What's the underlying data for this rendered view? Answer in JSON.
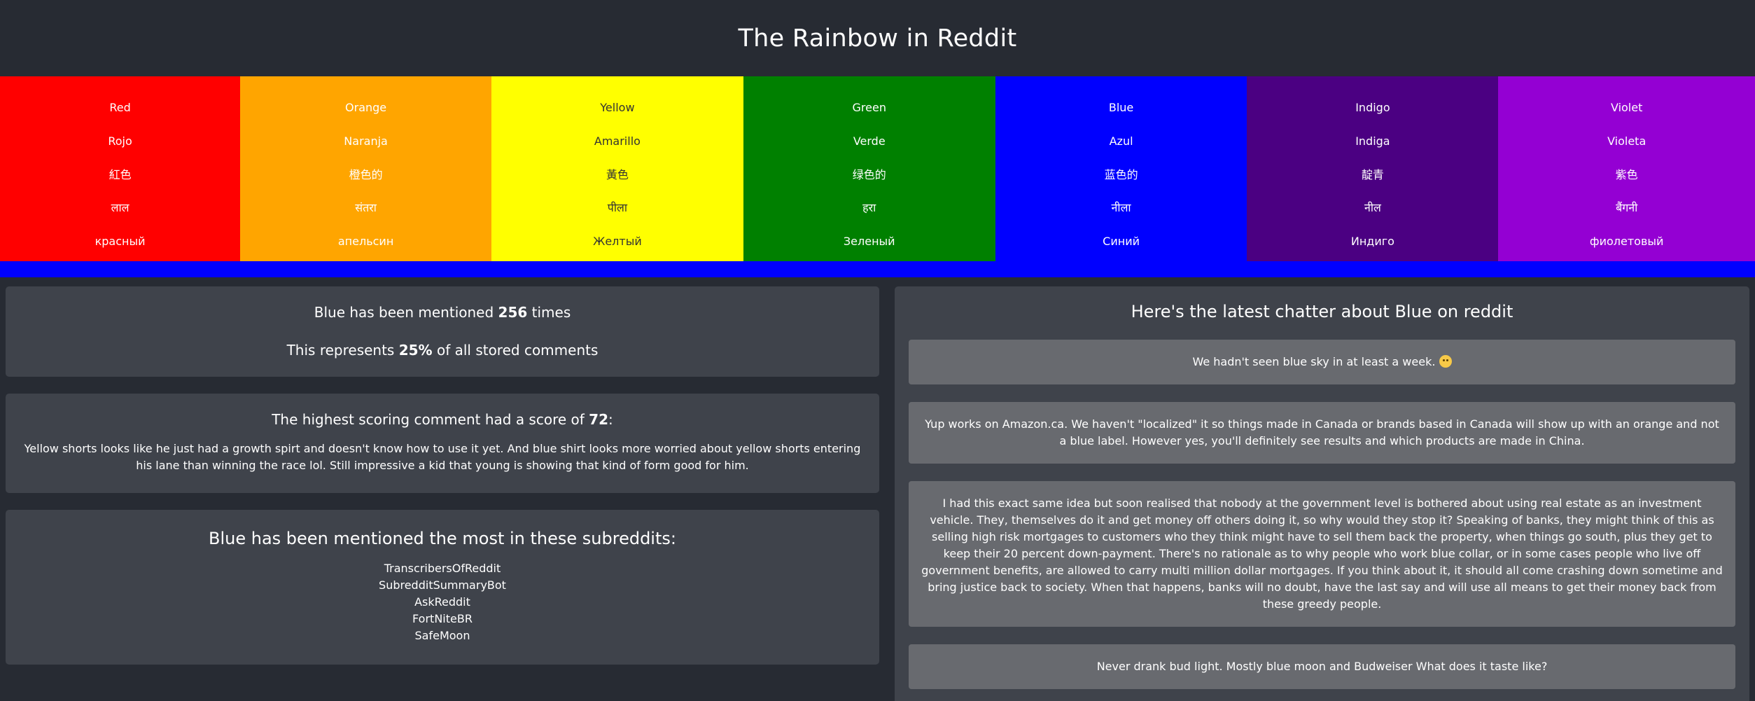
{
  "header": {
    "title": "The Rainbow in Reddit"
  },
  "colors": [
    {
      "key": "red",
      "hex": "#ff0000",
      "text": "#ffffff",
      "names": [
        "Red",
        "Rojo",
        "紅色",
        "लाल",
        "красный"
      ]
    },
    {
      "key": "orange",
      "hex": "#ffa500",
      "text": "#ffffff",
      "names": [
        "Orange",
        "Naranja",
        "橙色的",
        "संतरा",
        "апельсин"
      ]
    },
    {
      "key": "yellow",
      "hex": "#ffff00",
      "text": "#333333",
      "names": [
        "Yellow",
        "Amarillo",
        "黃色",
        "पीला",
        "Желтый"
      ]
    },
    {
      "key": "green",
      "hex": "#008000",
      "text": "#ffffff",
      "names": [
        "Green",
        "Verde",
        "绿色的",
        "हरा",
        "Зеленый"
      ]
    },
    {
      "key": "blue",
      "hex": "#0000ff",
      "text": "#ffffff",
      "names": [
        "Blue",
        "Azul",
        "蓝色的",
        "नीला",
        "Синий"
      ]
    },
    {
      "key": "indigo",
      "hex": "#4b0082",
      "text": "#ffffff",
      "names": [
        "Indigo",
        "Indiga",
        "靛青",
        "नील",
        "Индиго"
      ]
    },
    {
      "key": "violet",
      "hex": "#9400d3",
      "text": "#ffffff",
      "names": [
        "Violet",
        "Violeta",
        "紫色",
        "बैंगनी",
        "фиолетовый"
      ]
    }
  ],
  "accent_color": "#0000ff",
  "stats": {
    "mention_prefix": "Blue has been mentioned ",
    "mention_count": "256",
    "mention_suffix": " times",
    "represent_prefix": "This represents ",
    "percent": "25%",
    "represent_suffix": " of all stored comments"
  },
  "top_comment": {
    "heading_prefix": "The highest scoring comment had a score of ",
    "score": "72",
    "heading_suffix": ":",
    "text": "Yellow shorts looks like he just had a growth spirt and doesn't know how to use it yet. And blue shirt looks more worried about yellow shorts entering his lane than winning the race lol. Still impressive a kid that young is showing that kind of form good for him."
  },
  "subreddits": {
    "heading": "Blue has been mentioned the most in these subreddits:",
    "items": [
      "TranscribersOfReddit",
      "SubredditSummaryBot",
      "AskReddit",
      "FortNiteBR",
      "SafeMoon"
    ]
  },
  "chatter": {
    "heading": "Here's the latest chatter about Blue on reddit",
    "comments": [
      "We hadn't seen blue sky in at least a week.",
      "Yup works on Amazon.ca. We haven't \"localized\" it so things made in Canada or brands based in Canada will show up with an orange and not a blue label. However yes, you'll definitely see results and which products are made in China.",
      "I had this exact same idea but soon realised that nobody at the government level is bothered about using real estate as an investment vehicle. They, themselves do it and get money off others doing it, so why would they stop it? Speaking of banks, they might think of this as selling high risk mortgages to customers who they think might have to sell them back the property, when things go south, plus they get to keep their 20 percent down-payment. There's no rationale as to why people who work blue collar, or in some cases people who live off government benefits, are allowed to carry multi million dollar mortgages. If you think about it, it should all come crashing down sometime and bring justice back to society. When that happens, banks will no doubt, have the last say and will use all means to get their money back from these greedy people.",
      "Never drank bud light. Mostly blue moon and Budweiser What does it taste like?"
    ],
    "first_comment_emoji": "slightly-frowning-face-icon"
  }
}
